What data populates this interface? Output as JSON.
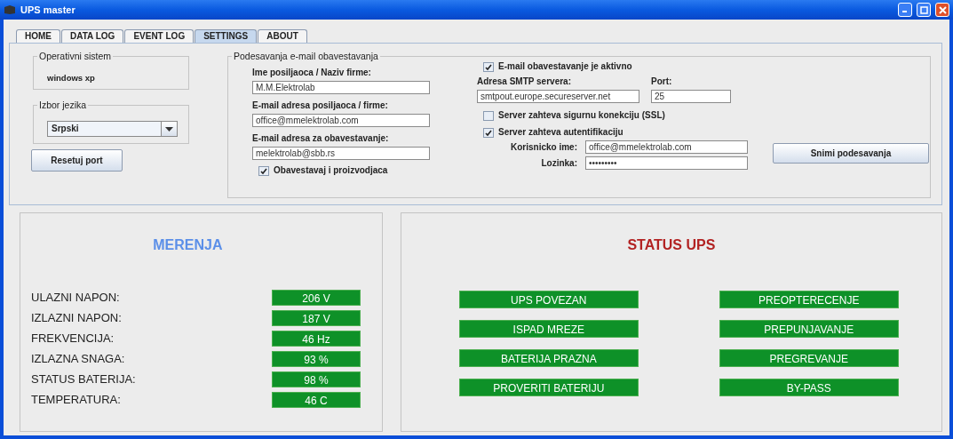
{
  "window": {
    "title": "UPS master"
  },
  "tabs": [
    {
      "label": "HOME",
      "selected": false
    },
    {
      "label": "DATA LOG",
      "selected": false
    },
    {
      "label": "EVENT LOG",
      "selected": false
    },
    {
      "label": "SETTINGS",
      "selected": true
    },
    {
      "label": "ABOUT",
      "selected": false
    }
  ],
  "settings": {
    "os_group": {
      "legend": "Operativni sistem",
      "value": "windows xp"
    },
    "language_group": {
      "legend": "Izbor jezika",
      "selected_value": "Srpski"
    },
    "reset_button": "Resetuj port",
    "email_group": {
      "legend": "Podesavanja e-mail obavestavanja",
      "sender_fields": [
        {
          "label": "Ime posiljaoca / Naziv firme:",
          "value": "M.M.Elektrolab"
        },
        {
          "label": "E-mail adresa posiljaoca / firme:",
          "value": "office@mmelektrolab.com"
        },
        {
          "label": "E-mail adresa za obavestavanje:",
          "value": "melektrolab@sbb.rs"
        }
      ],
      "notify_manufacturer": {
        "label": "Obavestavaj i proizvodjaca",
        "checked": true
      },
      "email_active": {
        "label": "E-mail obavestavanje je aktivno",
        "checked": true
      },
      "smtp": {
        "label": "Adresa SMTP servera:",
        "value": "smtpout.europe.secureserver.net"
      },
      "port": {
        "label": "Port:",
        "value": "25"
      },
      "ssl": {
        "label": "Server zahteva sigurnu konekciju (SSL)",
        "checked": false
      },
      "auth": {
        "label": "Server zahteva autentifikaciju",
        "checked": true
      },
      "username": {
        "label": "Korisnicko ime:",
        "value": "office@mmelektrolab.com"
      },
      "password": {
        "label": "Lozinka:",
        "value": "•••••••••"
      },
      "save_button": "Snimi podesavanja"
    }
  },
  "measurements": {
    "title": "MERENJA",
    "rows": [
      {
        "label": "ULAZNI NAPON:",
        "value": "206 V"
      },
      {
        "label": "IZLAZNI NAPON:",
        "value": "187 V"
      },
      {
        "label": "FREKVENCIJA:",
        "value": "46 Hz"
      },
      {
        "label": "IZLAZNA SNAGA:",
        "value": "93 %"
      },
      {
        "label": "STATUS BATERIJA:",
        "value": "98 %"
      },
      {
        "label": "TEMPERATURA:",
        "value": "46 C"
      }
    ]
  },
  "status": {
    "title": "STATUS UPS",
    "indicators": [
      {
        "label": "UPS POVEZAN",
        "on": true
      },
      {
        "label": "PREOPTERECENJE",
        "on": true
      },
      {
        "label": "ISPAD MREZE",
        "on": true
      },
      {
        "label": "PREPUNJAVANJE",
        "on": true
      },
      {
        "label": "BATERIJA PRAZNA",
        "on": true
      },
      {
        "label": "PREGREVANJE",
        "on": true
      },
      {
        "label": "PROVERITI BATERIJU",
        "on": true
      },
      {
        "label": "BY-PASS",
        "on": true
      }
    ]
  }
}
